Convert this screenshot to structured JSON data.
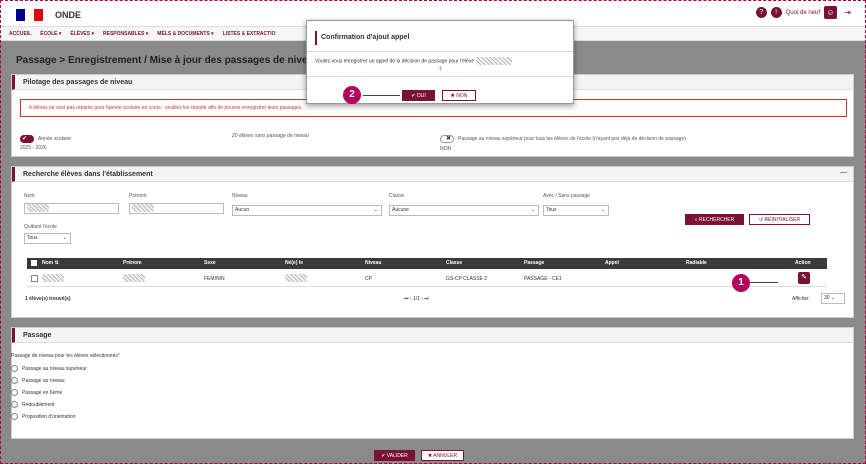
{
  "header": {
    "brand": "ONDE",
    "whats_new": "Quoi de neuf"
  },
  "menu": [
    "ACCUEIL",
    "ÉCOLE ▾",
    "ÉLÈVES ▾",
    "RESPONSABLES ▾",
    "MÈLS & DOCUMENTS ▾",
    "LISTES & EXTRACTIO"
  ],
  "page_title": "Passage > Enregistrement / Mise à jour des passages de nivea",
  "pilotage": {
    "title": "Pilotage des passages de niveau",
    "warning": "4 élèves ne sont pas répartis pour l'année scolaire en cours : veuillez les répartir afin de pouvoir enregistrer leurs passages.",
    "year_label": "Année scolaire",
    "year_value": "2025 - 2026",
    "no_passage": "20 élèves sans passage de niveau",
    "pass_all": "Passage au niveau supérieur pour tous les élèves de l'école (n'ayant pas déjà de décision de passage)",
    "pass_all_value": "NON"
  },
  "recherche": {
    "title": "Recherche élèves dans l'établissement",
    "nom_label": "Nom",
    "prenom_label": "Prénom",
    "niveau_label": "Niveau",
    "niveau_value": "Aucun",
    "classe_label": "Classe",
    "classe_value": "Aucune",
    "avec_label": "Avec / Sans passage",
    "avec_value": "Tous",
    "quittant_label": "Quittant l'école",
    "quittant_value": "Tous",
    "search_btn": "RECHERCHER",
    "reset_btn": "RÉINITIALISER"
  },
  "table": {
    "headers": [
      "Nom ⇅",
      "Prénom",
      "Sexe",
      "Né(e) le",
      "Niveau",
      "Classe",
      "Passage",
      "Appel",
      "Radiable",
      "Action"
    ],
    "row": {
      "sexe": "FEMININ",
      "niveau": "CP",
      "classe": "GS-CP CLASSE 2",
      "passage": "PASSAGE - CE1"
    },
    "count": "1 élève(s) trouvé(s)",
    "pagination": "1/1",
    "show_label": "Afficher",
    "show_value": "30"
  },
  "passage": {
    "title": "Passage",
    "subtitle": "Passage de niveau pour les élèves sélectionnés",
    "required": "*",
    "options": [
      "Passage au niveau supérieur",
      "Passage au niveau",
      "Passage en 6ème",
      "Redoublement",
      "Proposition d'orientation"
    ]
  },
  "footer": {
    "validate": "✔ VALIDER",
    "cancel": "✖ ANNULER"
  },
  "modal": {
    "title": "Confirmation d'ajout appel",
    "question": "Voulez-vous enregistrer un appel de la décision de passage pour l'élève",
    "question_end": "?",
    "yes": "✔ OUI",
    "no": "✖ NON"
  },
  "markers": {
    "one": "1",
    "two": "2"
  },
  "colors": {
    "accent": "#7a1232",
    "marker": "#b5005e"
  }
}
